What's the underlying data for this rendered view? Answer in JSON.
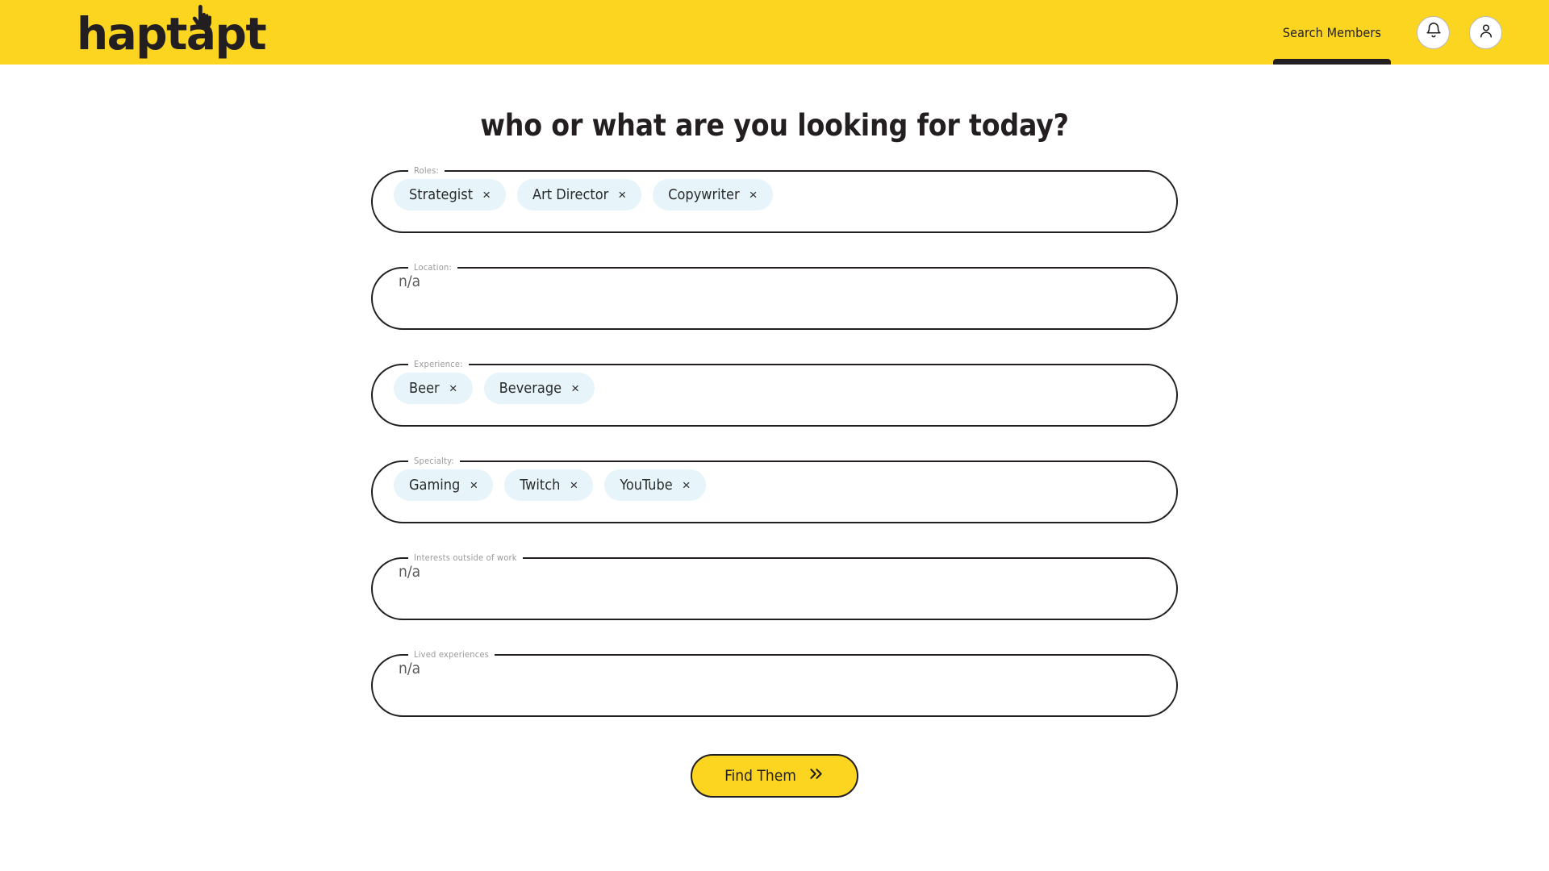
{
  "brand": {
    "name": "haptapt",
    "hand_icon": "pointing-hand-icon"
  },
  "header": {
    "nav_tab_label": "Search Members",
    "notifications_icon": "bell-icon",
    "account_icon": "user-avatar-icon",
    "background_color": "#fcd520"
  },
  "main": {
    "title": "who or what are you looking for today?"
  },
  "fields": [
    {
      "legend": "Roles:",
      "type": "chips",
      "chips": [
        {
          "label": "Strategist",
          "remove": "×"
        },
        {
          "label": "Art Director",
          "remove": "×"
        },
        {
          "label": "Copywriter",
          "remove": "×"
        }
      ]
    },
    {
      "legend": "Location:",
      "type": "text",
      "value": "n/a"
    },
    {
      "legend": "Experience:",
      "type": "chips",
      "chips": [
        {
          "label": "Beer",
          "remove": "×"
        },
        {
          "label": "Beverage",
          "remove": "×"
        }
      ]
    },
    {
      "legend": "Specialty:",
      "type": "chips",
      "chips": [
        {
          "label": "Gaming",
          "remove": "×"
        },
        {
          "label": "Twitch",
          "remove": "×"
        },
        {
          "label": "YouTube",
          "remove": "×"
        }
      ]
    },
    {
      "legend": "Interests outside of work",
      "type": "text",
      "value": "n/a"
    },
    {
      "legend": "Lived experiences",
      "type": "text",
      "value": "n/a"
    }
  ],
  "submit": {
    "label": "Find Them",
    "icon": "double-chevron-right-icon"
  },
  "colors": {
    "brand_yellow": "#fcd520",
    "ink": "#231f20",
    "chip_background": "#e7f5fb",
    "legend_gray": "#9a9a9a"
  }
}
